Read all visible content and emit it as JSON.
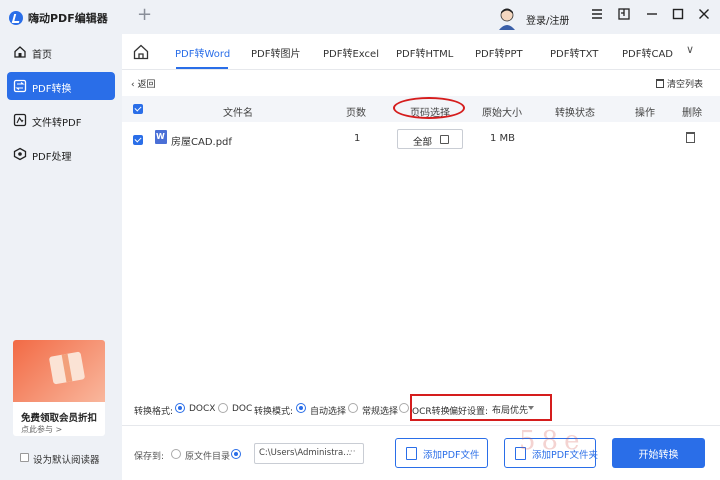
{
  "app": {
    "title": "嗨动PDF编辑器",
    "new_tab": "+",
    "login": "登录/注册",
    "window_controls": [
      "menu-icon",
      "pin-icon",
      "minimize-icon",
      "maximize-icon",
      "close-icon"
    ]
  },
  "sidebar": {
    "items": [
      {
        "label": "首页",
        "icon": "home-icon"
      },
      {
        "label": "PDF转换",
        "icon": "convert-icon",
        "active": true
      },
      {
        "label": "文件转PDF",
        "icon": "file-to-pdf-icon"
      },
      {
        "label": "PDF处理",
        "icon": "pdf-process-icon"
      }
    ],
    "promo": {
      "title": "免费领取会员折扣",
      "link": "点此参与 >"
    },
    "default_reader": "设为默认阅读器"
  },
  "tabs": {
    "items": [
      "PDF转Word",
      "PDF转图片",
      "PDF转Excel",
      "PDF转HTML",
      "PDF转PPT",
      "PDF转TXT",
      "PDF转CAD"
    ],
    "active": "PDF转Word",
    "more": "∨"
  },
  "toolbar": {
    "back": "返回",
    "clear_list": "清空列表"
  },
  "table": {
    "headers": [
      "文件名",
      "页数",
      "页码选择",
      "原始大小",
      "转换状态",
      "操作",
      "删除"
    ],
    "rows": [
      {
        "name": "房屋CAD.pdf",
        "pages": "1",
        "page_select": "全部",
        "size": "1 MB",
        "status": "",
        "action": ""
      }
    ]
  },
  "options": {
    "format_label": "转换格式:",
    "format_docx": "DOCX",
    "format_doc": "DOC",
    "mode_label": "转换模式:",
    "mode_auto": "自动选择",
    "mode_normal": "常规选择",
    "mode_ocr": "OCR转换",
    "pref_label": "偏好设置:",
    "pref_value": "布局优先"
  },
  "bottom": {
    "save_to": "保存到:",
    "original_dir": "原文件目录",
    "path": "C:\\Users\\Administra...",
    "path_more": "···",
    "add_pdf": "添加PDF文件",
    "add_folder": "添加PDF文件夹",
    "start": "开始转换",
    "watermark": "58e"
  },
  "colors": {
    "accent": "#2a6ee8",
    "annotation": "#d51d1d"
  }
}
